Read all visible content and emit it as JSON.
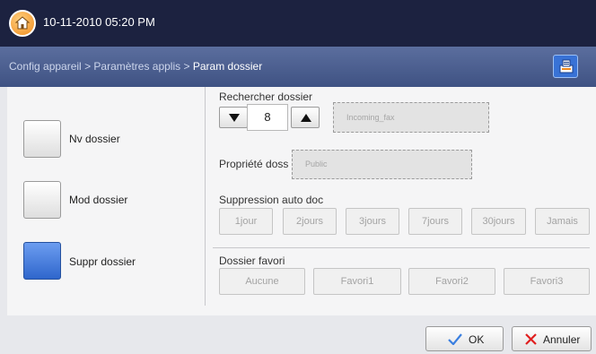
{
  "header": {
    "datetime": "10-11-2010 05:20 PM",
    "breadcrumb": {
      "config": "Config appareil",
      "apps": "Paramètres applis",
      "current": "Param dossier",
      "separator": ">"
    }
  },
  "sidebar": {
    "items": [
      {
        "label": "Nv dossier",
        "active": false
      },
      {
        "label": "Mod dossier",
        "active": false
      },
      {
        "label": "Suppr dossier",
        "active": true
      }
    ]
  },
  "search": {
    "label": "Rechercher dossier",
    "value": "8",
    "folder_name": "Incoming_fax"
  },
  "property": {
    "label": "Propriété doss",
    "value": "Public"
  },
  "auto_delete": {
    "label": "Suppression auto doc",
    "options": [
      "1jour",
      "2jours",
      "3jours",
      "7jours",
      "30jours",
      "Jamais"
    ]
  },
  "favorite": {
    "label": "Dossier favori",
    "options": [
      "Aucune",
      "Favori1",
      "Favori2",
      "Favori3"
    ]
  },
  "footer": {
    "ok_label": "OK",
    "cancel_label": "Annuler"
  },
  "colors": {
    "topbar": "#1c2240",
    "breadcrumb_bar": "#4a5d8f",
    "active_button": "#3f78dc",
    "ok_check": "#3a7fe0",
    "cancel_x": "#e02020"
  },
  "icons": {
    "home": "home-icon",
    "job_status": "job-status-icon",
    "down": "arrow-down-icon",
    "up": "arrow-up-icon",
    "ok": "checkmark-icon",
    "cancel": "x-icon"
  }
}
